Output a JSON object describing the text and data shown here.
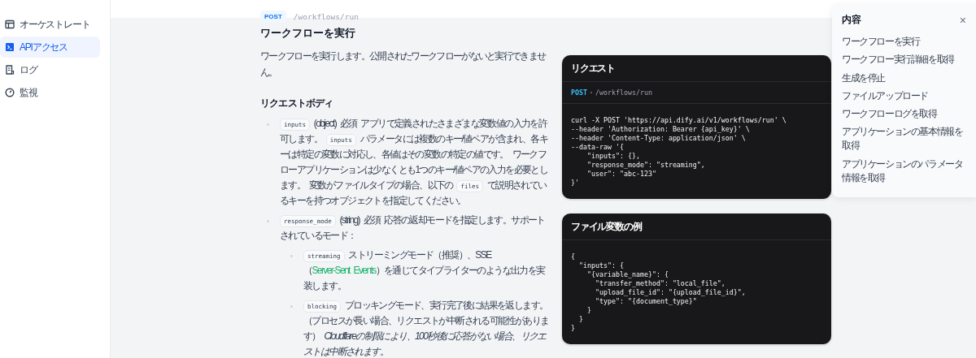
{
  "sidebar": {
    "items": [
      {
        "label": "オーケストレート",
        "kind": "layout",
        "selected": false
      },
      {
        "label": "APIアクセス",
        "kind": "terminal",
        "selected": true
      },
      {
        "label": "ログ",
        "kind": "document",
        "selected": false
      },
      {
        "label": "監視",
        "kind": "gauge",
        "selected": false
      }
    ]
  },
  "endpoint": {
    "method": "POST",
    "path": "/workflows/run"
  },
  "title": "ワークフローを実行",
  "description": "ワークフローを実行します。公開されたワークフローがないと実行できません。",
  "section_heading": "リクエストボディ",
  "params": [
    {
      "parts": [
        {
          "kind": "code",
          "text": "inputs"
        },
        {
          "kind": "text",
          "text": " (object) 必須 アプリで定義されたさまざまな変数値の入力を許可します。 "
        },
        {
          "kind": "code",
          "text": "inputs"
        },
        {
          "kind": "text",
          "text": " パラメータには複数のキー/値ペアが含まれ、各キーは特定の変数に対応し、各値はその変数の特定の値です。 ワークフローアプリケーションは少なくとも1つのキー/値ペアの入力を必要とします。 変数がファイルタイプの場合、以下の "
        },
        {
          "kind": "code",
          "text": "files"
        },
        {
          "kind": "text",
          "text": " で説明されているキーを持つオブジェクトを指定してください。"
        }
      ]
    },
    {
      "parts": [
        {
          "kind": "code",
          "text": "response_mode"
        },
        {
          "kind": "text",
          "text": " (string) 必須 応答の返却モードを指定します。サポートされているモード："
        }
      ],
      "children": [
        {
          "parts": [
            {
              "kind": "code",
              "text": "streaming"
            },
            {
              "kind": "text",
              "text": " ストリーミングモード（推奨）、SSE（"
            },
            {
              "kind": "link",
              "text": "Server-Sent Events"
            },
            {
              "kind": "text",
              "text": "）を通じてタイプライターのような出力を実装します。"
            }
          ]
        },
        {
          "parts": [
            {
              "kind": "code",
              "text": "blocking"
            },
            {
              "kind": "text",
              "text": " ブロッキングモード、実行完了後に結果を返します。（プロセスが長い場合、リクエストが中断される可能性があります） *Cloudflareの制限により、100秒後に応答がない場合、リクエストは中断されます。*"
            }
          ]
        }
      ]
    }
  ],
  "request_panel": {
    "title": "リクエスト",
    "method": "POST",
    "path": "/workflows/run",
    "code": "curl -X POST 'https://api.dify.ai/v1/workflows/run' \\\n--header 'Authorization: Bearer {api_key}' \\\n--header 'Content-Type: application/json' \\\n--data-raw '{\n    \"inputs\": {},\n    \"response_mode\": \"streaming\",\n    \"user\": \"abc-123\"\n}'"
  },
  "file_panel": {
    "title": "ファイル変数の例",
    "code": "{\n  \"inputs\": {\n    \"{variable_name}\": {\n      \"transfer_method\": \"local_file\",\n      \"upload_file_id\": \"{upload_file_id}\",\n      \"type\": \"{document_type}\"\n    }\n  }\n}"
  },
  "toc": {
    "title": "内容",
    "close": "×",
    "items": [
      "ワークフローを実行",
      "ワークフロー実行詳細を取得",
      "生成を停止",
      "ファイルアップロード",
      "ワークフローログを取得",
      "アプリケーションの基本情報を取得",
      "アプリケーションのパラメータ情報を取得"
    ]
  }
}
